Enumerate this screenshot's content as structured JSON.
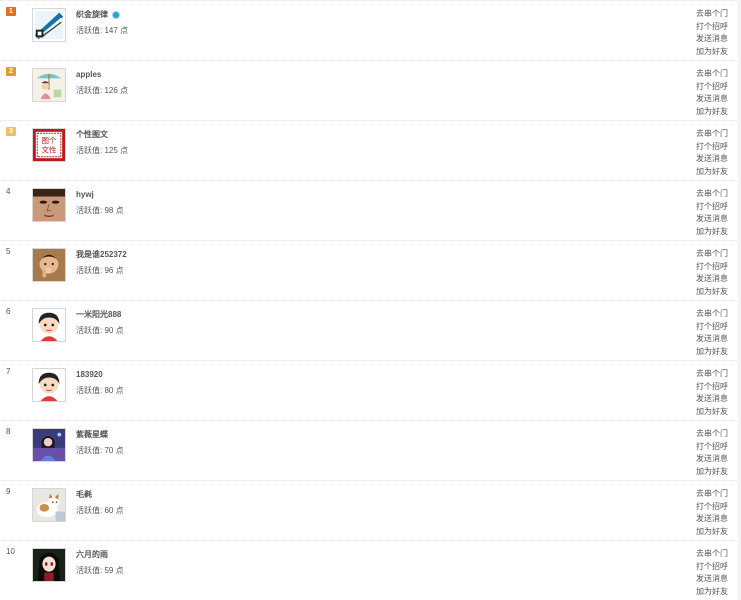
{
  "score_label": "活跃值:",
  "score_unit": "点",
  "actions": [
    "去串个门",
    "打个招呼",
    "发送消息",
    "加为好友"
  ],
  "medal_colors": [
    "#e0701a",
    "#e89a22",
    "#eec063"
  ],
  "users": [
    {
      "rank": "1",
      "name": "织金旋律",
      "score": "147",
      "verified": true,
      "avatar_icon": "qr-style-avatar"
    },
    {
      "rank": "2",
      "name": "apples",
      "score": "126",
      "verified": false,
      "avatar_icon": "girl-with-parasol-avatar"
    },
    {
      "rank": "3",
      "name": "个性图文",
      "score": "125",
      "verified": false,
      "avatar_icon": "red-chinese-text-avatar",
      "avatar_text": [
        "图个",
        "文性"
      ]
    },
    {
      "rank": "4",
      "name": "hywj",
      "score": "98",
      "verified": false,
      "avatar_icon": "face-closeup-avatar"
    },
    {
      "rank": "5",
      "name": "我是谁252372",
      "score": "96",
      "verified": false,
      "avatar_icon": "child-photo-avatar"
    },
    {
      "rank": "6",
      "name": "一米阳光888",
      "score": "90",
      "verified": false,
      "avatar_icon": "cartoon-boy-avatar"
    },
    {
      "rank": "7",
      "name": "183920",
      "score": "80",
      "verified": false,
      "avatar_icon": "cartoon-boy-avatar"
    },
    {
      "rank": "8",
      "name": "紫薇星蝶",
      "score": "70",
      "verified": false,
      "avatar_icon": "purple-photo-avatar"
    },
    {
      "rank": "9",
      "name": "毛毵",
      "score": "60",
      "verified": false,
      "avatar_icon": "cat-avatar"
    },
    {
      "rank": "10",
      "name": "六月的雨",
      "score": "59",
      "verified": false,
      "avatar_icon": "anime-girl-avatar"
    }
  ]
}
